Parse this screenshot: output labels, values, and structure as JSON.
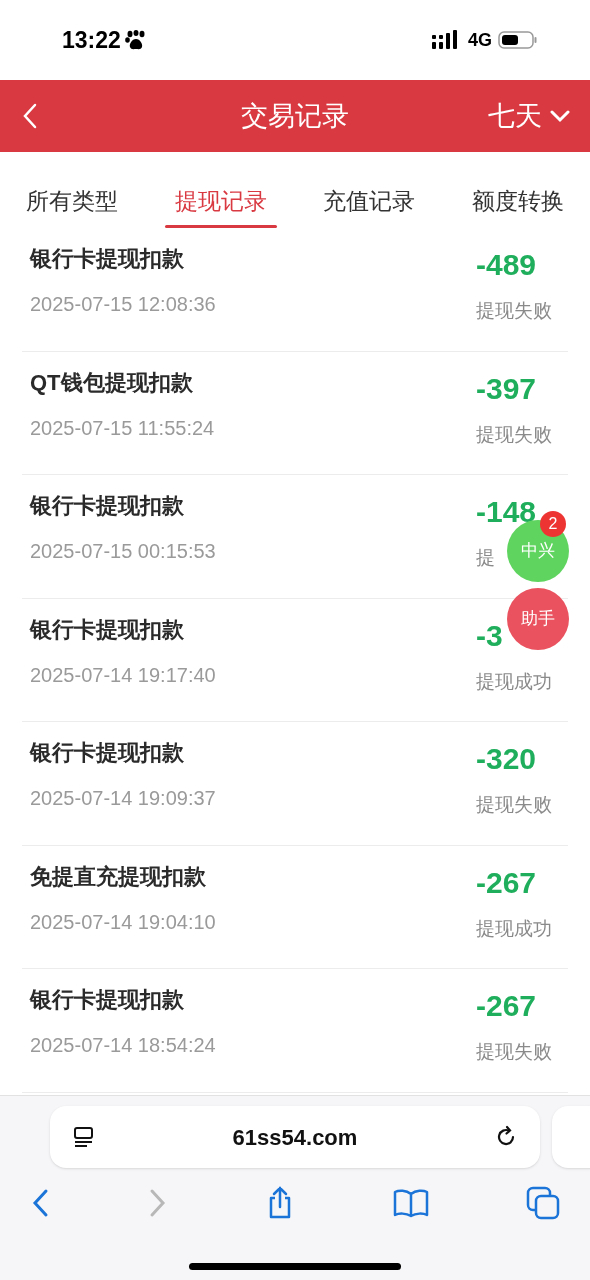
{
  "status_bar": {
    "time": "13:22",
    "network": "4G"
  },
  "header": {
    "title": "交易记录",
    "range": "七天"
  },
  "tabs": [
    {
      "label": "所有类型",
      "selected": false
    },
    {
      "label": "提现记录",
      "selected": true
    },
    {
      "label": "充值记录",
      "selected": false
    },
    {
      "label": "额度转换",
      "selected": false
    }
  ],
  "records": [
    {
      "title": "银行卡提现扣款",
      "time": "2025-07-15 12:08:36",
      "amount": "-489",
      "status": "提现失败"
    },
    {
      "title": "QT钱包提现扣款",
      "time": "2025-07-15 11:55:24",
      "amount": "-397",
      "status": "提现失败"
    },
    {
      "title": "银行卡提现扣款",
      "time": "2025-07-15 00:15:53",
      "amount": "-148",
      "status": "提"
    },
    {
      "title": "银行卡提现扣款",
      "time": "2025-07-14 19:17:40",
      "amount": "-3",
      "status": "提现成功"
    },
    {
      "title": "银行卡提现扣款",
      "time": "2025-07-14 19:09:37",
      "amount": "-320",
      "status": "提现失败"
    },
    {
      "title": "免提直充提现扣款",
      "time": "2025-07-14 19:04:10",
      "amount": "-267",
      "status": "提现成功"
    },
    {
      "title": "银行卡提现扣款",
      "time": "2025-07-14 18:54:24",
      "amount": "-267",
      "status": "提现失败"
    }
  ],
  "floating_buttons": [
    {
      "label": "中兴",
      "badge": "2",
      "color": "#5fd45f"
    },
    {
      "label": "助手",
      "color": "#e9525e"
    }
  ],
  "browser": {
    "url": "61ss54.com"
  }
}
